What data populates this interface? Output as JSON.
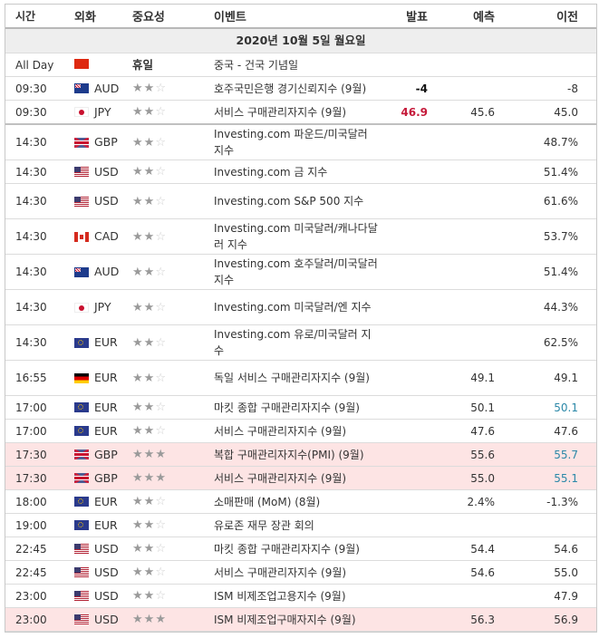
{
  "header": {
    "time": "시간",
    "currency": "외화",
    "importance": "중요성",
    "event": "이벤트",
    "actual": "발표",
    "forecast": "예측",
    "previous": "이전"
  },
  "date_label": "2020년 10월 5일 월요일",
  "holiday": {
    "time": "All Day",
    "flag": "china-flag",
    "label": "휴일",
    "event": "중국 - 건국 기념일"
  },
  "rows": [
    {
      "time": "09:30",
      "flag": "australia-flag",
      "currency": "AUD",
      "stars": 2,
      "event": "호주국민은행 경기신뢰지수 (9월)",
      "actual": "-4",
      "actual_style": "bold",
      "forecast": "",
      "previous": "-8",
      "previous_style": "",
      "highlight": false
    },
    {
      "time": "09:30",
      "flag": "japan-flag",
      "currency": "JPY",
      "stars": 2,
      "event": "서비스 구매관리자지수 (9월)",
      "actual": "46.9",
      "actual_style": "red",
      "forecast": "45.6",
      "previous": "45.0",
      "previous_style": "",
      "highlight": false
    },
    {
      "time": "14:30",
      "flag": "uk-flag",
      "currency": "GBP",
      "stars": 2,
      "event": "Investing.com 파운드/미국달러 지수",
      "actual": "",
      "forecast": "",
      "previous": "48.7%",
      "previous_style": "",
      "highlight": false
    },
    {
      "time": "14:30",
      "flag": "us-flag",
      "currency": "USD",
      "stars": 2,
      "event": "Investing.com 금 지수",
      "actual": "",
      "forecast": "",
      "previous": "51.4%",
      "previous_style": "",
      "highlight": false
    },
    {
      "time": "14:30",
      "flag": "us-flag",
      "currency": "USD",
      "stars": 2,
      "event": "Investing.com S&P 500 지수",
      "actual": "",
      "forecast": "",
      "previous": "61.6%",
      "previous_style": "",
      "highlight": false
    },
    {
      "time": "14:30",
      "flag": "canada-flag",
      "currency": "CAD",
      "stars": 2,
      "event": "Investing.com 미국달러/캐나다달러 지수",
      "actual": "",
      "forecast": "",
      "previous": "53.7%",
      "previous_style": "",
      "highlight": false
    },
    {
      "time": "14:30",
      "flag": "australia-flag",
      "currency": "AUD",
      "stars": 2,
      "event": "Investing.com 호주달러/미국달러 지수",
      "actual": "",
      "forecast": "",
      "previous": "51.4%",
      "previous_style": "",
      "highlight": false
    },
    {
      "time": "14:30",
      "flag": "japan-flag",
      "currency": "JPY",
      "stars": 2,
      "event": "Investing.com 미국달러/엔 지수",
      "actual": "",
      "forecast": "",
      "previous": "44.3%",
      "previous_style": "",
      "highlight": false
    },
    {
      "time": "14:30",
      "flag": "eu-flag",
      "currency": "EUR",
      "stars": 2,
      "event": "Investing.com 유로/미국달러 지수",
      "actual": "",
      "forecast": "",
      "previous": "62.5%",
      "previous_style": "",
      "highlight": false
    },
    {
      "time": "16:55",
      "flag": "germany-flag",
      "currency": "EUR",
      "stars": 2,
      "event": "독일 서비스 구매관리자지수 (9월)",
      "actual": "",
      "forecast": "49.1",
      "previous": "49.1",
      "previous_style": "",
      "highlight": false
    },
    {
      "time": "17:00",
      "flag": "eu-flag",
      "currency": "EUR",
      "stars": 2,
      "event": "마킷 종합 구매관리자지수 (9월)",
      "actual": "",
      "forecast": "50.1",
      "previous": "50.1",
      "previous_style": "blue",
      "highlight": false
    },
    {
      "time": "17:00",
      "flag": "eu-flag",
      "currency": "EUR",
      "stars": 2,
      "event": "서비스 구매관리자지수 (9월)",
      "actual": "",
      "forecast": "47.6",
      "previous": "47.6",
      "previous_style": "",
      "highlight": false
    },
    {
      "time": "17:30",
      "flag": "uk-flag",
      "currency": "GBP",
      "stars": 3,
      "event": "복합 구매관리자지수(PMI) (9월)",
      "actual": "",
      "forecast": "55.6",
      "previous": "55.7",
      "previous_style": "blue",
      "highlight": true
    },
    {
      "time": "17:30",
      "flag": "uk-flag",
      "currency": "GBP",
      "stars": 3,
      "event": "서비스 구매관리자지수 (9월)",
      "actual": "",
      "forecast": "55.0",
      "previous": "55.1",
      "previous_style": "blue",
      "highlight": true
    },
    {
      "time": "18:00",
      "flag": "eu-flag",
      "currency": "EUR",
      "stars": 2,
      "event": "소매판매 (MoM) (8월)",
      "actual": "",
      "forecast": "2.4%",
      "previous": "-1.3%",
      "previous_style": "",
      "highlight": false
    },
    {
      "time": "19:00",
      "flag": "eu-flag",
      "currency": "EUR",
      "stars": 2,
      "event": "유로존 재무 장관 회의",
      "actual": "",
      "forecast": "",
      "previous": "",
      "previous_style": "",
      "highlight": false
    },
    {
      "time": "22:45",
      "flag": "us-flag",
      "currency": "USD",
      "stars": 2,
      "event": "마킷 종합 구매관리자지수 (9월)",
      "actual": "",
      "forecast": "54.4",
      "previous": "54.6",
      "previous_style": "",
      "highlight": false
    },
    {
      "time": "22:45",
      "flag": "us-flag",
      "currency": "USD",
      "stars": 2,
      "event": "서비스 구매관리자지수 (9월)",
      "actual": "",
      "forecast": "54.6",
      "previous": "55.0",
      "previous_style": "",
      "highlight": false
    },
    {
      "time": "23:00",
      "flag": "us-flag",
      "currency": "USD",
      "stars": 2,
      "event": "ISM 비제조업고용지수 (9월)",
      "actual": "",
      "forecast": "",
      "previous": "47.9",
      "previous_style": "",
      "highlight": false
    },
    {
      "time": "23:00",
      "flag": "us-flag",
      "currency": "USD",
      "stars": 3,
      "event": "ISM 비제조업구매자지수 (9월)",
      "actual": "",
      "forecast": "56.3",
      "previous": "56.9",
      "previous_style": "",
      "highlight": true
    }
  ],
  "colors": {
    "actual_up": "#c51a3a",
    "previous_revised": "#2b88a8",
    "highlight_row": "#fde4e4",
    "date_bar": "#eeeeee"
  }
}
